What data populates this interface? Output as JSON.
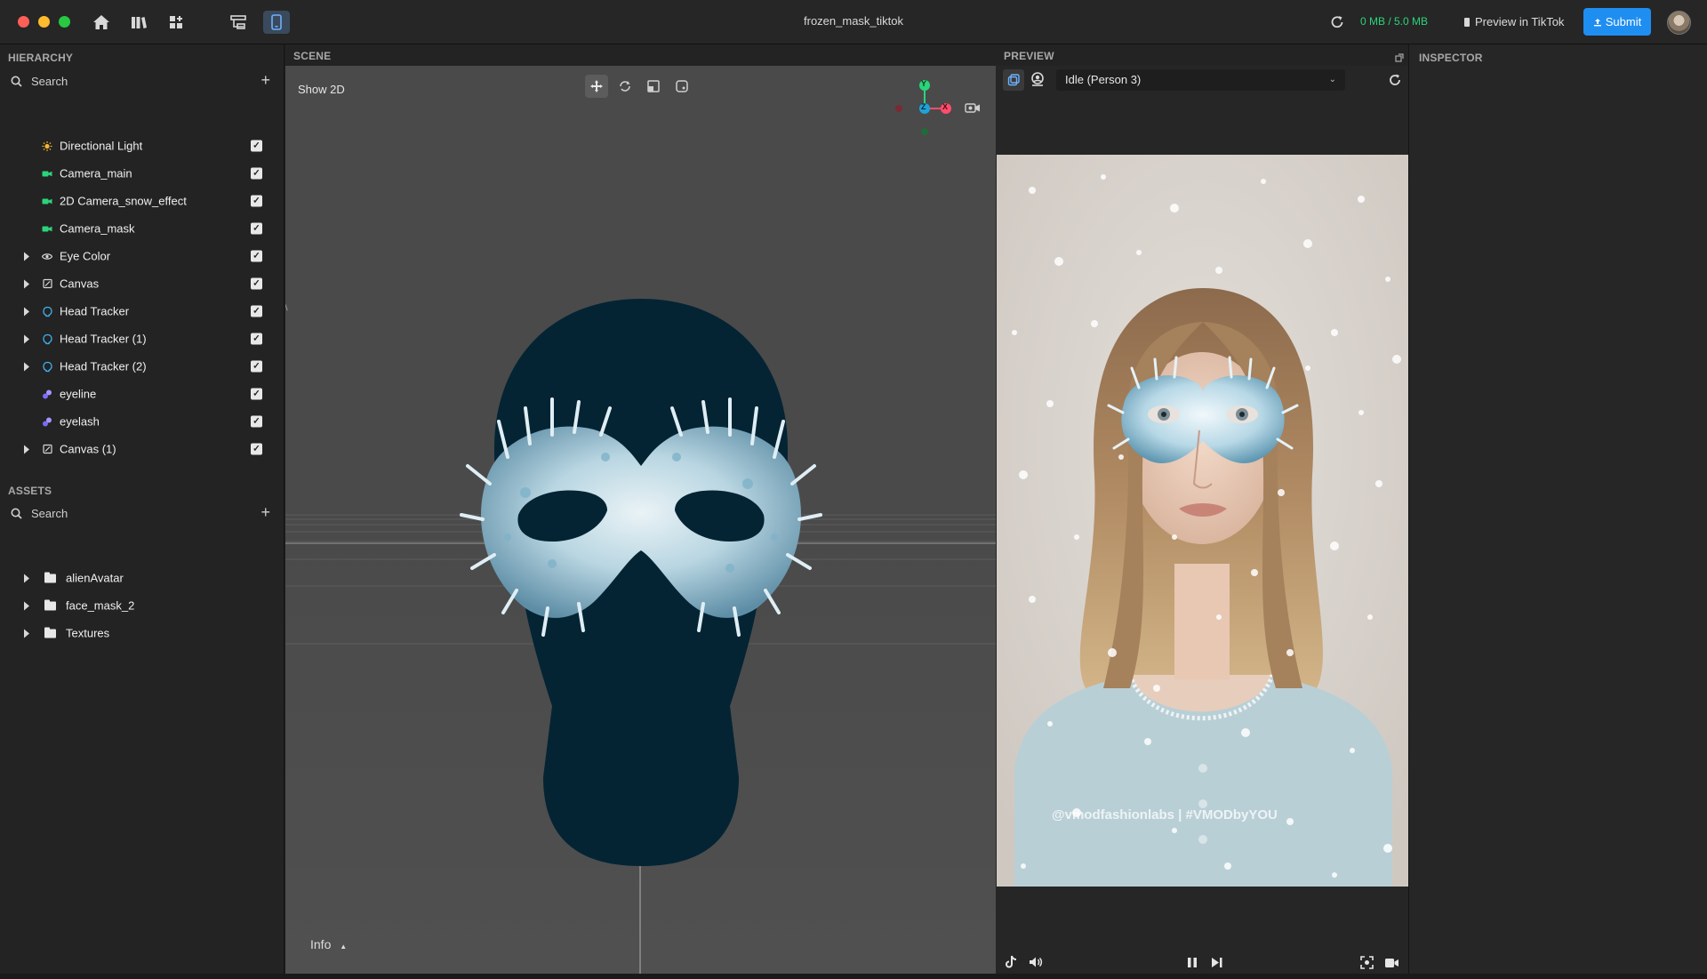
{
  "window": {
    "title": "frozen_mask_tiktok",
    "memory": "0 MB / 5.0 MB",
    "preview_label": "Preview in TikTok",
    "submit_label": "Submit"
  },
  "hierarchy": {
    "title": "HIERARCHY",
    "search_placeholder": "Search",
    "items": [
      {
        "label": "Directional Light",
        "icon": "sun-icon",
        "expandable": false
      },
      {
        "label": "Camera_main",
        "icon": "camera-icon",
        "expandable": false
      },
      {
        "label": "2D Camera_snow_effect",
        "icon": "camera-icon",
        "expandable": false
      },
      {
        "label": "Camera_mask",
        "icon": "camera-icon",
        "expandable": false
      },
      {
        "label": "Eye Color",
        "icon": "eye-icon",
        "expandable": true
      },
      {
        "label": "Canvas",
        "icon": "canvas-icon",
        "expandable": true
      },
      {
        "label": "Head Tracker",
        "icon": "head-icon",
        "expandable": true
      },
      {
        "label": "Head Tracker (1)",
        "icon": "head-icon",
        "expandable": true
      },
      {
        "label": "Head Tracker (2)",
        "icon": "head-icon",
        "expandable": true
      },
      {
        "label": "eyeline",
        "icon": "mesh-icon",
        "expandable": false
      },
      {
        "label": "eyelash",
        "icon": "mesh-icon",
        "expandable": false
      },
      {
        "label": "Canvas (1)",
        "icon": "canvas-icon",
        "expandable": true
      }
    ]
  },
  "assets": {
    "title": "ASSETS",
    "search_placeholder": "Search",
    "items": [
      {
        "label": "alienAvatar"
      },
      {
        "label": "face_mask_2"
      },
      {
        "label": "Textures"
      }
    ]
  },
  "scene": {
    "title": "SCENE",
    "show2d_label": "Show 2D",
    "info_label": "Info",
    "gizmo": {
      "y": "Y",
      "x": "X",
      "z": "Z"
    }
  },
  "preview": {
    "title": "PREVIEW",
    "person_option": "Idle (Person 3)",
    "watermark": "@vmodfashionlabs | #VMODbyYOU"
  },
  "inspector": {
    "title": "INSPECTOR"
  },
  "colors": {
    "accent": "#1f8ef1",
    "memory_green": "#2bd47a",
    "head_fill": "#042434"
  }
}
